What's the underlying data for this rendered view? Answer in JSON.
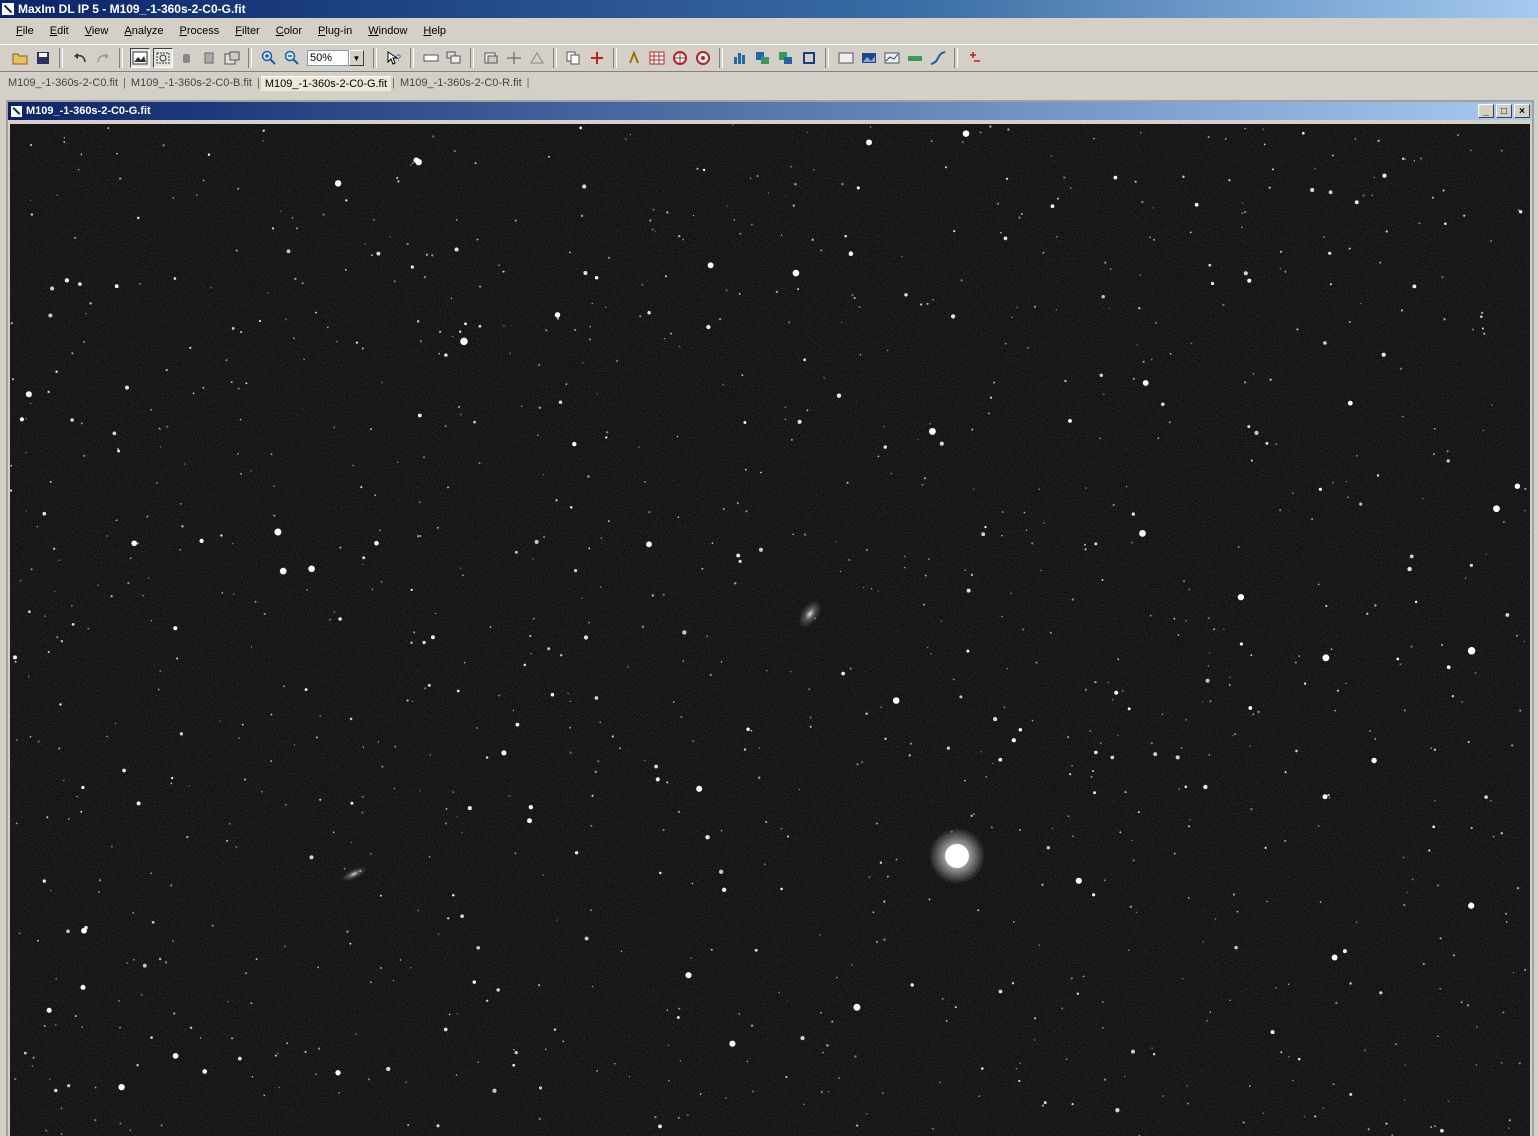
{
  "window": {
    "title": "MaxIm DL IP 5 - M109_-1-360s-2-C0-G.fit"
  },
  "menu": {
    "items": [
      {
        "key": "F",
        "rest": "ile"
      },
      {
        "key": "E",
        "rest": "dit"
      },
      {
        "key": "V",
        "rest": "iew"
      },
      {
        "key": "A",
        "rest": "nalyze"
      },
      {
        "key": "P",
        "rest": "rocess"
      },
      {
        "key": "F",
        "rest": "ilter"
      },
      {
        "key": "C",
        "rest": "olor"
      },
      {
        "key": "P",
        "rest": "lug-in"
      },
      {
        "key": "W",
        "rest": "indow"
      },
      {
        "key": "H",
        "rest": "elp"
      }
    ]
  },
  "toolbar": {
    "zoom_value": "50%",
    "icons": {
      "open": "open-folder-icon",
      "save": "save-disk-icon",
      "undo": "undo-icon",
      "redo": "redo-icon",
      "zoom_in": "zoom-in-icon",
      "zoom_out": "zoom-out-icon",
      "help": "context-help-icon"
    }
  },
  "tabs": [
    {
      "label": "M109_-1-360s-2-C0.fit",
      "active": false
    },
    {
      "label": "M109_-1-360s-2-C0-B.fit",
      "active": false
    },
    {
      "label": "M109_-1-360s-2-C0-G.fit",
      "active": true
    },
    {
      "label": "M109_-1-360s-2-C0-R.fit",
      "active": false
    }
  ],
  "document": {
    "title": "M109_-1-360s-2-C0-G.fit",
    "buttons": {
      "minimize": "_",
      "maximize": "□",
      "close": "×"
    }
  },
  "image": {
    "background_color": "#101010",
    "star_color": "#ffffff",
    "content": "star-field"
  }
}
